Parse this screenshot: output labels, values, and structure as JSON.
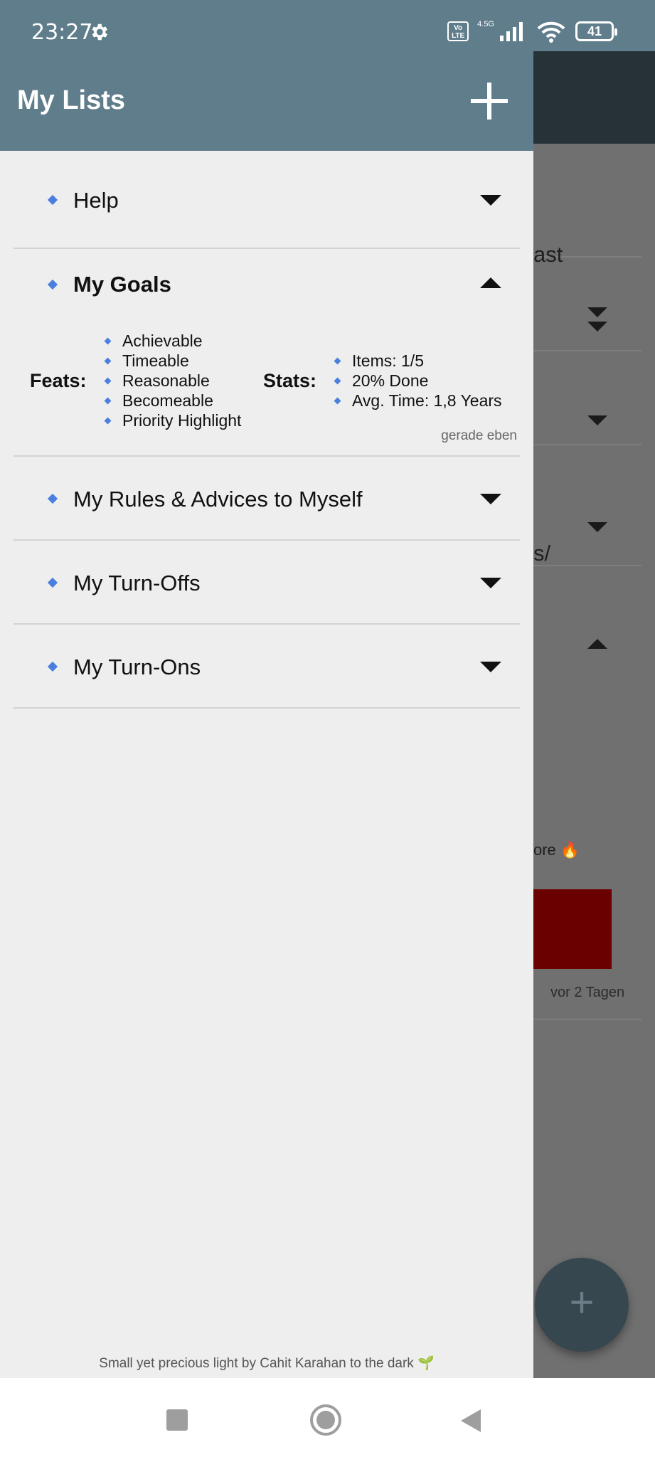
{
  "status_bar": {
    "time": "23:27",
    "network": "4.5G",
    "volte": "Vo LTE",
    "battery": "41",
    "icons": [
      "gear-icon",
      "volte-icon",
      "signal-icon",
      "wifi-icon",
      "battery-icon"
    ]
  },
  "drawer": {
    "title": "My Lists",
    "add_icon": "plus-icon",
    "items": [
      {
        "title": "Help",
        "expanded": false
      },
      {
        "title": "My Goals",
        "expanded": true,
        "feats_label": "Feats:",
        "feats": [
          "Achievable",
          "Timeable",
          "Reasonable",
          "Becomeable",
          "Priority Highlight"
        ],
        "stats_label": "Stats:",
        "stats": [
          "Items: 1/5",
          "20% Done",
          "Avg. Time: 1,8 Years"
        ],
        "updated": "gerade eben"
      },
      {
        "title": "My Rules & Advices to Myself",
        "expanded": false
      },
      {
        "title": "My Turn-Offs",
        "expanded": false
      },
      {
        "title": "My Turn-Ons",
        "expanded": false
      }
    ],
    "footer": "Small yet precious light by Cahit Karahan to the dark 🌱"
  },
  "background": {
    "row1_text": "ast",
    "row4_text": "s/",
    "row6_text": "ore 🔥",
    "timestamp": "vor 2 Tagen",
    "fab_icon": "plus-icon",
    "fab_label": "+"
  },
  "colors": {
    "header": "#607d8b",
    "toolbar_dark": "#263238",
    "accent_bullet": "#4a7fe0",
    "drawer_bg": "#eeeeee",
    "highlight_red": "#6b0000"
  }
}
